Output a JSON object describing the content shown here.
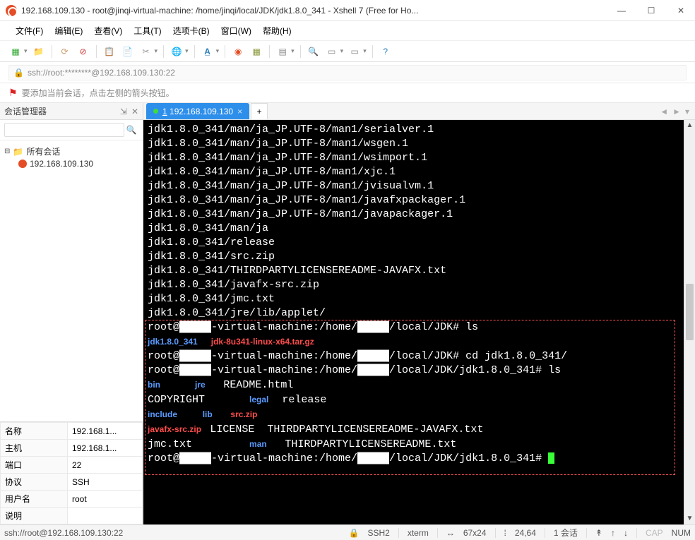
{
  "window": {
    "title": "192.168.109.130 - root@jinqi-virtual-machine: /home/jinqi/local/JDK/jdk1.8.0_341 - Xshell 7 (Free for Ho...",
    "min": "—",
    "max": "☐",
    "close": "✕"
  },
  "menu": {
    "file": "文件(F)",
    "edit": "编辑(E)",
    "view": "查看(V)",
    "tools": "工具(T)",
    "tabs": "选项卡(B)",
    "window": "窗口(W)",
    "help": "帮助(H)"
  },
  "address": {
    "url": "ssh://root:********@192.168.109.130:22"
  },
  "hint": {
    "text": "要添加当前会话，点击左侧的箭头按钮。"
  },
  "sidebar": {
    "title": "会话管理器",
    "pin": "⇲",
    "close": "✕",
    "root": "所有会话",
    "session": "192.168.109.130"
  },
  "props": {
    "rows": [
      {
        "k": "名称",
        "v": "192.168.1..."
      },
      {
        "k": "主机",
        "v": "192.168.1..."
      },
      {
        "k": "端口",
        "v": "22"
      },
      {
        "k": "协议",
        "v": "SSH"
      },
      {
        "k": "用户名",
        "v": "root"
      },
      {
        "k": "说明",
        "v": ""
      }
    ]
  },
  "tab": {
    "label": "1 192.168.109.130",
    "add": "+"
  },
  "term": {
    "lines": [
      "jdk1.8.0_341/man/ja_JP.UTF-8/man1/serialver.1",
      "jdk1.8.0_341/man/ja_JP.UTF-8/man1/wsgen.1",
      "jdk1.8.0_341/man/ja_JP.UTF-8/man1/wsimport.1",
      "jdk1.8.0_341/man/ja_JP.UTF-8/man1/xjc.1",
      "jdk1.8.0_341/man/ja_JP.UTF-8/man1/jvisualvm.1",
      "jdk1.8.0_341/man/ja_JP.UTF-8/man1/javafxpackager.1",
      "jdk1.8.0_341/man/ja_JP.UTF-8/man1/javapackager.1",
      "jdk1.8.0_341/man/ja",
      "jdk1.8.0_341/release",
      "jdk1.8.0_341/src.zip",
      "jdk1.8.0_341/THIRDPARTYLICENSEREADME-JAVAFX.txt",
      "jdk1.8.0_341/javafx-src.zip",
      "jdk1.8.0_341/jmc.txt",
      "jdk1.8.0_341/jre/lib/applet/"
    ],
    "p1a": "root@",
    "p1vm": "-virtual-machine:/home/",
    "p1path": "/local/JDK# ",
    "p1cmd": "ls",
    "ls1a": "jdk1.8.0_341",
    "ls1b": "jdk-8u341-linux-x64.tar.gz",
    "p2cmd": "cd jdk1.8.0_341/",
    "p3path": "/local/JDK/jdk1.8.0_341# ",
    "p3cmd": "ls",
    "c_bin": "bin",
    "c_jre": "jre",
    "c_readme": "README.html",
    "c_copy": "COPYRIGHT",
    "c_legal": "legal",
    "c_release": "release",
    "c_incl": "include",
    "c_lib": "lib",
    "c_src": "src.zip",
    "c_jfx": "javafx-src.zip",
    "c_lic": "LICENSE",
    "c_t1": "THIRDPARTYLICENSEREADME-JAVAFX.txt",
    "c_jmc": "jmc.txt",
    "c_man": "man",
    "c_t2": "THIRDPARTYLICENSEREADME.txt",
    "blk": "█████"
  },
  "status": {
    "left": "ssh://root@192.168.109.130:22",
    "proto": "SSH2",
    "termtype": "xterm",
    "size": "67x24",
    "pos": "24,64",
    "sess": "1 会话",
    "cap": "CAP",
    "num": "NUM",
    "nav1": "↟",
    "nav2": "↑",
    "nav3": "↓"
  }
}
